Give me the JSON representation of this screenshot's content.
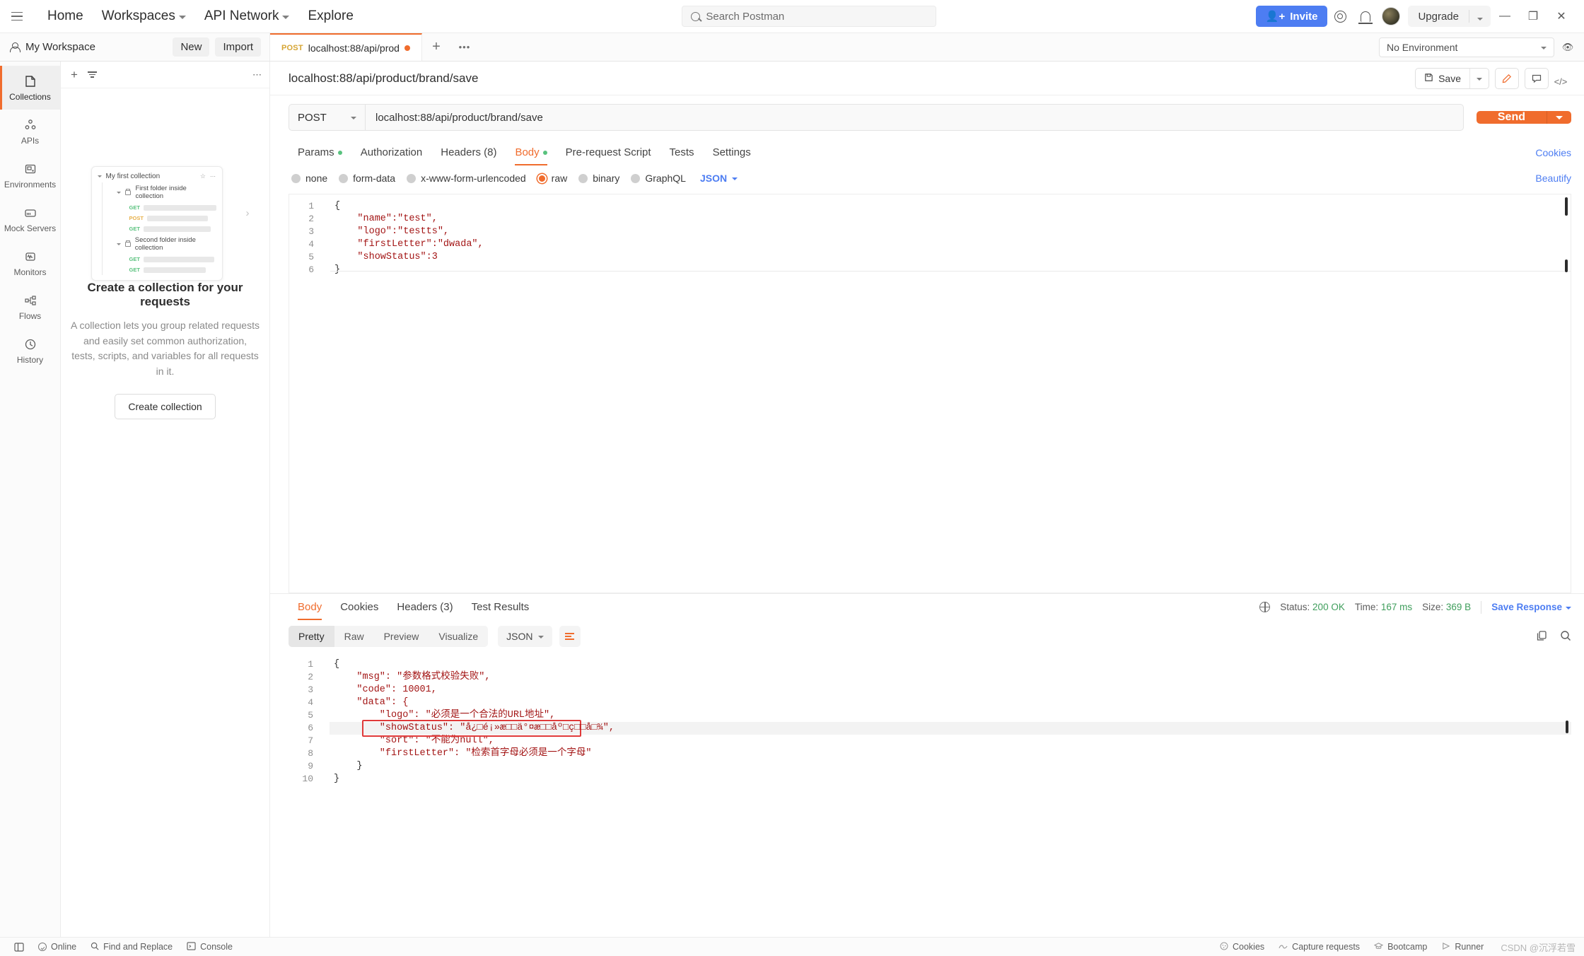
{
  "topbar": {
    "menu_icon": "hamburger-icon",
    "nav": [
      {
        "label": "Home",
        "caret": false
      },
      {
        "label": "Workspaces",
        "caret": true
      },
      {
        "label": "API Network",
        "caret": true
      },
      {
        "label": "Explore",
        "caret": false
      }
    ],
    "search_placeholder": "Search Postman",
    "invite_label": "Invite",
    "upgrade_label": "Upgrade",
    "window_min": "—",
    "window_max": "❐",
    "window_close": "✕"
  },
  "workspacebar": {
    "workspace_name": "My Workspace",
    "new_label": "New",
    "import_label": "Import",
    "tab": {
      "method": "POST",
      "name": "localhost:88/api/prod"
    },
    "plus_label": "+",
    "more_label": "•••",
    "environment_label": "No Environment"
  },
  "rail": [
    {
      "label": "Collections",
      "icon": "collections-icon",
      "active": true
    },
    {
      "label": "APIs",
      "icon": "apis-icon",
      "active": false
    },
    {
      "label": "Environments",
      "icon": "environments-icon",
      "active": false
    },
    {
      "label": "Mock Servers",
      "icon": "mock-servers-icon",
      "active": false
    },
    {
      "label": "Monitors",
      "icon": "monitors-icon",
      "active": false
    },
    {
      "label": "Flows",
      "icon": "flows-icon",
      "active": false
    },
    {
      "label": "History",
      "icon": "history-icon",
      "active": false
    }
  ],
  "sidebar": {
    "illustration": {
      "collection_name": "My first collection",
      "folders": [
        {
          "name": "First folder inside collection",
          "requests": [
            "GET",
            "POST",
            "GET"
          ]
        },
        {
          "name": "Second folder inside collection",
          "requests": [
            "GET",
            "GET"
          ]
        }
      ]
    },
    "empty_title": "Create a collection for your requests",
    "empty_desc": "A collection lets you group related requests and easily set common authorization, tests, scripts, and variables for all requests in it.",
    "create_button": "Create collection"
  },
  "request": {
    "title": "localhost:88/api/product/brand/save",
    "save_label": "Save",
    "method": "POST",
    "url": "localhost:88/api/product/brand/save",
    "send_label": "Send",
    "tabs": [
      {
        "label": "Params",
        "dot": true,
        "active": false
      },
      {
        "label": "Authorization",
        "dot": false,
        "active": false
      },
      {
        "label": "Headers (8)",
        "dot": false,
        "active": false
      },
      {
        "label": "Body",
        "dot": true,
        "active": true
      },
      {
        "label": "Pre-request Script",
        "dot": false,
        "active": false
      },
      {
        "label": "Tests",
        "dot": false,
        "active": false
      },
      {
        "label": "Settings",
        "dot": false,
        "active": false
      }
    ],
    "cookies_link": "Cookies",
    "body_types": [
      {
        "label": "none",
        "selected": false
      },
      {
        "label": "form-data",
        "selected": false
      },
      {
        "label": "x-www-form-urlencoded",
        "selected": false
      },
      {
        "label": "raw",
        "selected": true
      },
      {
        "label": "binary",
        "selected": false
      },
      {
        "label": "GraphQL",
        "selected": false
      }
    ],
    "body_format": "JSON",
    "beautify_label": "Beautify",
    "body_lines": [
      "{",
      "    \"name\":\"test\",",
      "    \"logo\":\"testts\",",
      "    \"firstLetter\":\"dwada\",",
      "    \"showStatus\":3",
      "}"
    ]
  },
  "response": {
    "tabs": [
      {
        "label": "Body",
        "active": true
      },
      {
        "label": "Cookies",
        "active": false
      },
      {
        "label": "Headers (3)",
        "active": false
      },
      {
        "label": "Test Results",
        "active": false
      }
    ],
    "status_label": "Status:",
    "status_value": "200 OK",
    "time_label": "Time:",
    "time_value": "167 ms",
    "size_label": "Size:",
    "size_value": "369 B",
    "save_response": "Save Response",
    "view_modes": [
      {
        "label": "Pretty",
        "active": true
      },
      {
        "label": "Raw",
        "active": false
      },
      {
        "label": "Preview",
        "active": false
      },
      {
        "label": "Visualize",
        "active": false
      }
    ],
    "format": "JSON",
    "body_lines": [
      "{",
      "    \"msg\": \"参数格式校验失败\",",
      "    \"code\": 10001,",
      "    \"data\": {",
      "        \"logo\": \"必须是一个合法的URL地址\",",
      "        \"showStatus\": \"å¿□é¡»æ□□ä°¤æ□□åº□ç□□å□¾\",",
      "        \"sort\": \"不能为null\",",
      "        \"firstLetter\": \"检索首字母必须是一个字母\"",
      "    }",
      "}"
    ],
    "highlighted_line": 6
  },
  "statusbar": {
    "items": [
      {
        "label": "Online",
        "icon": "online-icon"
      },
      {
        "label": "Find and Replace",
        "icon": "search-icon"
      },
      {
        "label": "Console",
        "icon": "console-icon"
      }
    ],
    "right_items": [
      {
        "label": "Cookies",
        "icon": "cookies-icon"
      },
      {
        "label": "Capture requests",
        "icon": "capture-icon"
      },
      {
        "label": "Bootcamp",
        "icon": "bootcamp-icon"
      },
      {
        "label": "Runner",
        "icon": "runner-icon"
      }
    ],
    "watermark": "CSDN @沉浮若雪"
  },
  "colors": {
    "accent": "#f06c2d",
    "link": "#4d7df2",
    "green": "#3f9e5c",
    "error": "#e03a3a"
  }
}
